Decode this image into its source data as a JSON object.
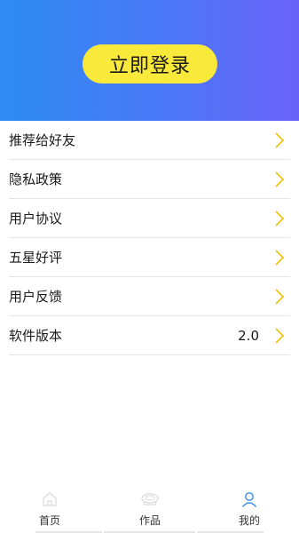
{
  "header": {
    "login_label": "立即登录"
  },
  "menu": {
    "items": [
      {
        "label": "推荐给好友",
        "value": ""
      },
      {
        "label": "隐私政策",
        "value": ""
      },
      {
        "label": "用户协议",
        "value": ""
      },
      {
        "label": "五星好评",
        "value": ""
      },
      {
        "label": "用户反馈",
        "value": ""
      },
      {
        "label": "软件版本",
        "value": "2.0"
      }
    ]
  },
  "tabbar": {
    "tabs": [
      {
        "label": "首页",
        "icon": "home-icon",
        "active": false
      },
      {
        "label": "作品",
        "icon": "works-icon",
        "active": false
      },
      {
        "label": "我的",
        "icon": "profile-icon",
        "active": true
      }
    ]
  },
  "colors": {
    "header_gradient_start": "#2e8cf2",
    "header_gradient_end": "#6a62f7",
    "login_button": "#f9e93b",
    "chevron": "#f2c31a",
    "active_tab_icon": "#3a8fe6"
  }
}
